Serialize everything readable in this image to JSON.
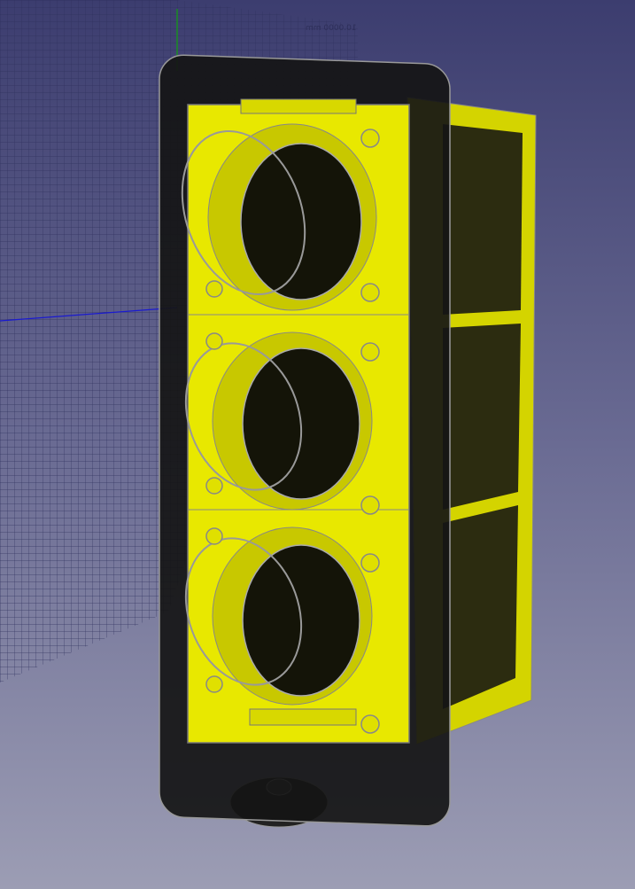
{
  "viewport": {
    "grid_label": "10.0000 mm",
    "colors": {
      "background_top": "#3c3d6f",
      "background_bottom": "#9c9db4",
      "part_yellow": "#e6e600",
      "frame": "#111111",
      "axis_blue": "#1010c0",
      "axis_green": "#10a010"
    },
    "model": {
      "holes": 3
    }
  }
}
